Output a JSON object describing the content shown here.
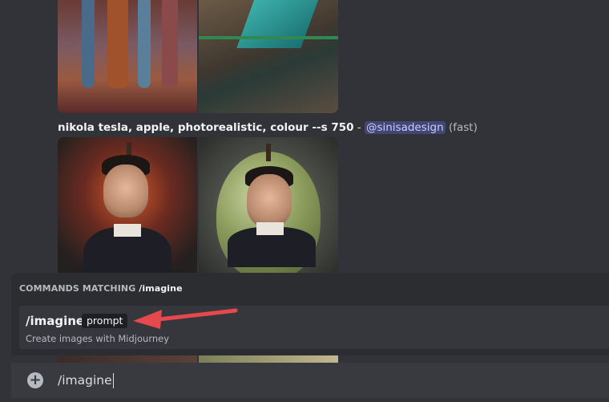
{
  "message": {
    "prompt_text": "nikola tesla, apple, photorealistic, colour --s 750",
    "separator": " - ",
    "mention": "@sinisadesign",
    "mode": "(fast)"
  },
  "command_menu": {
    "header_prefix": "COMMANDS MATCHING ",
    "header_query": "/imagine",
    "item": {
      "name": "/imagine",
      "option": "prompt",
      "description": "Create images with Midjourney"
    }
  },
  "composer": {
    "value": "/imagine",
    "plus_icon": "plus-circle-icon"
  },
  "annotation": {
    "arrow_color": "#e5484d",
    "arrow_icon": "arrow-left-icon"
  },
  "colors": {
    "background": "#313338",
    "mention_bg": "#414675",
    "mention_fg": "#c9cdfb"
  }
}
